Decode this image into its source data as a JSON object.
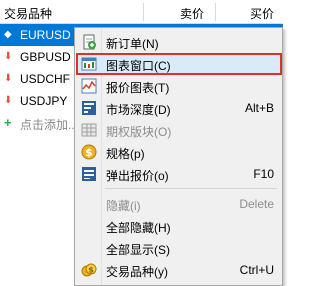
{
  "header": {
    "symbol": "交易品种",
    "bid": "卖价",
    "ask": "买价"
  },
  "rows": [
    {
      "symbol": "EURUSD",
      "direction": "up"
    },
    {
      "symbol": "GBPUSD",
      "direction": "down"
    },
    {
      "symbol": "USDCHF",
      "direction": "down"
    },
    {
      "symbol": "USDJPY",
      "direction": "down"
    }
  ],
  "add_row": "点击添加...",
  "menu": {
    "items": [
      {
        "label": "新订单(N)",
        "shortcut": "",
        "icon": "new-order-icon"
      },
      {
        "label": "图表窗口(C)",
        "shortcut": "",
        "icon": "chart-window-icon"
      },
      {
        "label": "报价图表(T)",
        "shortcut": "",
        "icon": "tick-chart-icon"
      },
      {
        "label": "市场深度(D)",
        "shortcut": "Alt+B",
        "icon": "market-depth-icon"
      },
      {
        "label": "期权版块(O)",
        "shortcut": "",
        "icon": "options-board-icon"
      },
      {
        "label": "规格(p)",
        "shortcut": "",
        "icon": "specification-icon"
      },
      {
        "label": "弹出报价(o)",
        "shortcut": "F10",
        "icon": "popup-prices-icon"
      },
      {
        "label": "隐藏(i)",
        "shortcut": "Delete",
        "icon": ""
      },
      {
        "label": "全部隐藏(H)",
        "shortcut": "",
        "icon": ""
      },
      {
        "label": "全部显示(S)",
        "shortcut": "",
        "icon": ""
      },
      {
        "label": "交易品种(y)",
        "shortcut": "Ctrl+U",
        "icon": "symbols-icon"
      }
    ]
  },
  "colors": {
    "selection": "#0078d7",
    "highlight_border": "#e0302a",
    "down": "#e0533a",
    "up": "#3b7dc4"
  }
}
